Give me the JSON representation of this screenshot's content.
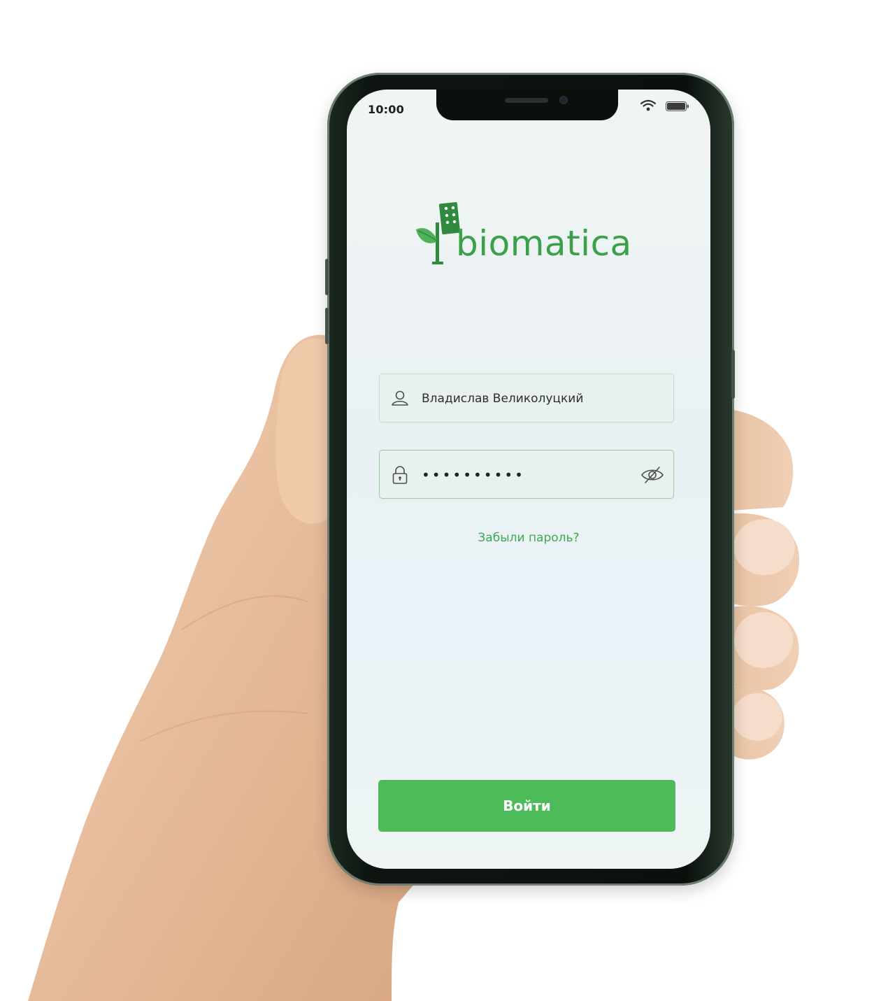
{
  "status_bar": {
    "time": "10:00",
    "wifi": "wifi-icon",
    "battery": "battery-icon"
  },
  "brand": {
    "name": "biomatica",
    "color": "#3aa04a",
    "logo_icon": "sprout-chip-icon"
  },
  "login_form": {
    "username": {
      "icon": "user-icon",
      "value": "Владислав Великолуцкий"
    },
    "password": {
      "icon": "lock-icon",
      "masked_value": "••••••••••",
      "toggle_icon": "eye-slash-icon"
    },
    "forgot_password_label": "Забыли пароль?",
    "submit_label": "Войти"
  },
  "colors": {
    "accent": "#4dbb5a",
    "link": "#3daa52",
    "screen_background": "#eaf1f5"
  }
}
